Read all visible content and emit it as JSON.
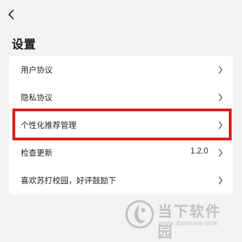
{
  "header": {
    "back_icon": "chevron-left-icon",
    "title": "设置"
  },
  "settings": {
    "items": [
      {
        "label": "用户协议",
        "value": "",
        "icon": "chevron-right-icon"
      },
      {
        "label": "隐私协议",
        "value": "",
        "icon": "chevron-right-icon"
      },
      {
        "label": "个性化推荐管理",
        "value": "",
        "icon": "chevron-right-icon",
        "highlighted": true
      },
      {
        "label": "检查更新",
        "value": "1.2.0",
        "icon": "chevron-right-icon"
      },
      {
        "label": "喜欢苏打校园，好评鼓励下",
        "value": "",
        "icon": "chevron-right-icon"
      }
    ]
  },
  "colors": {
    "background": "#f3f3f3",
    "card": "#ffffff",
    "highlight": "#e01919"
  },
  "watermark": {
    "title": "当下软件园",
    "url": "www.downxia.com"
  }
}
